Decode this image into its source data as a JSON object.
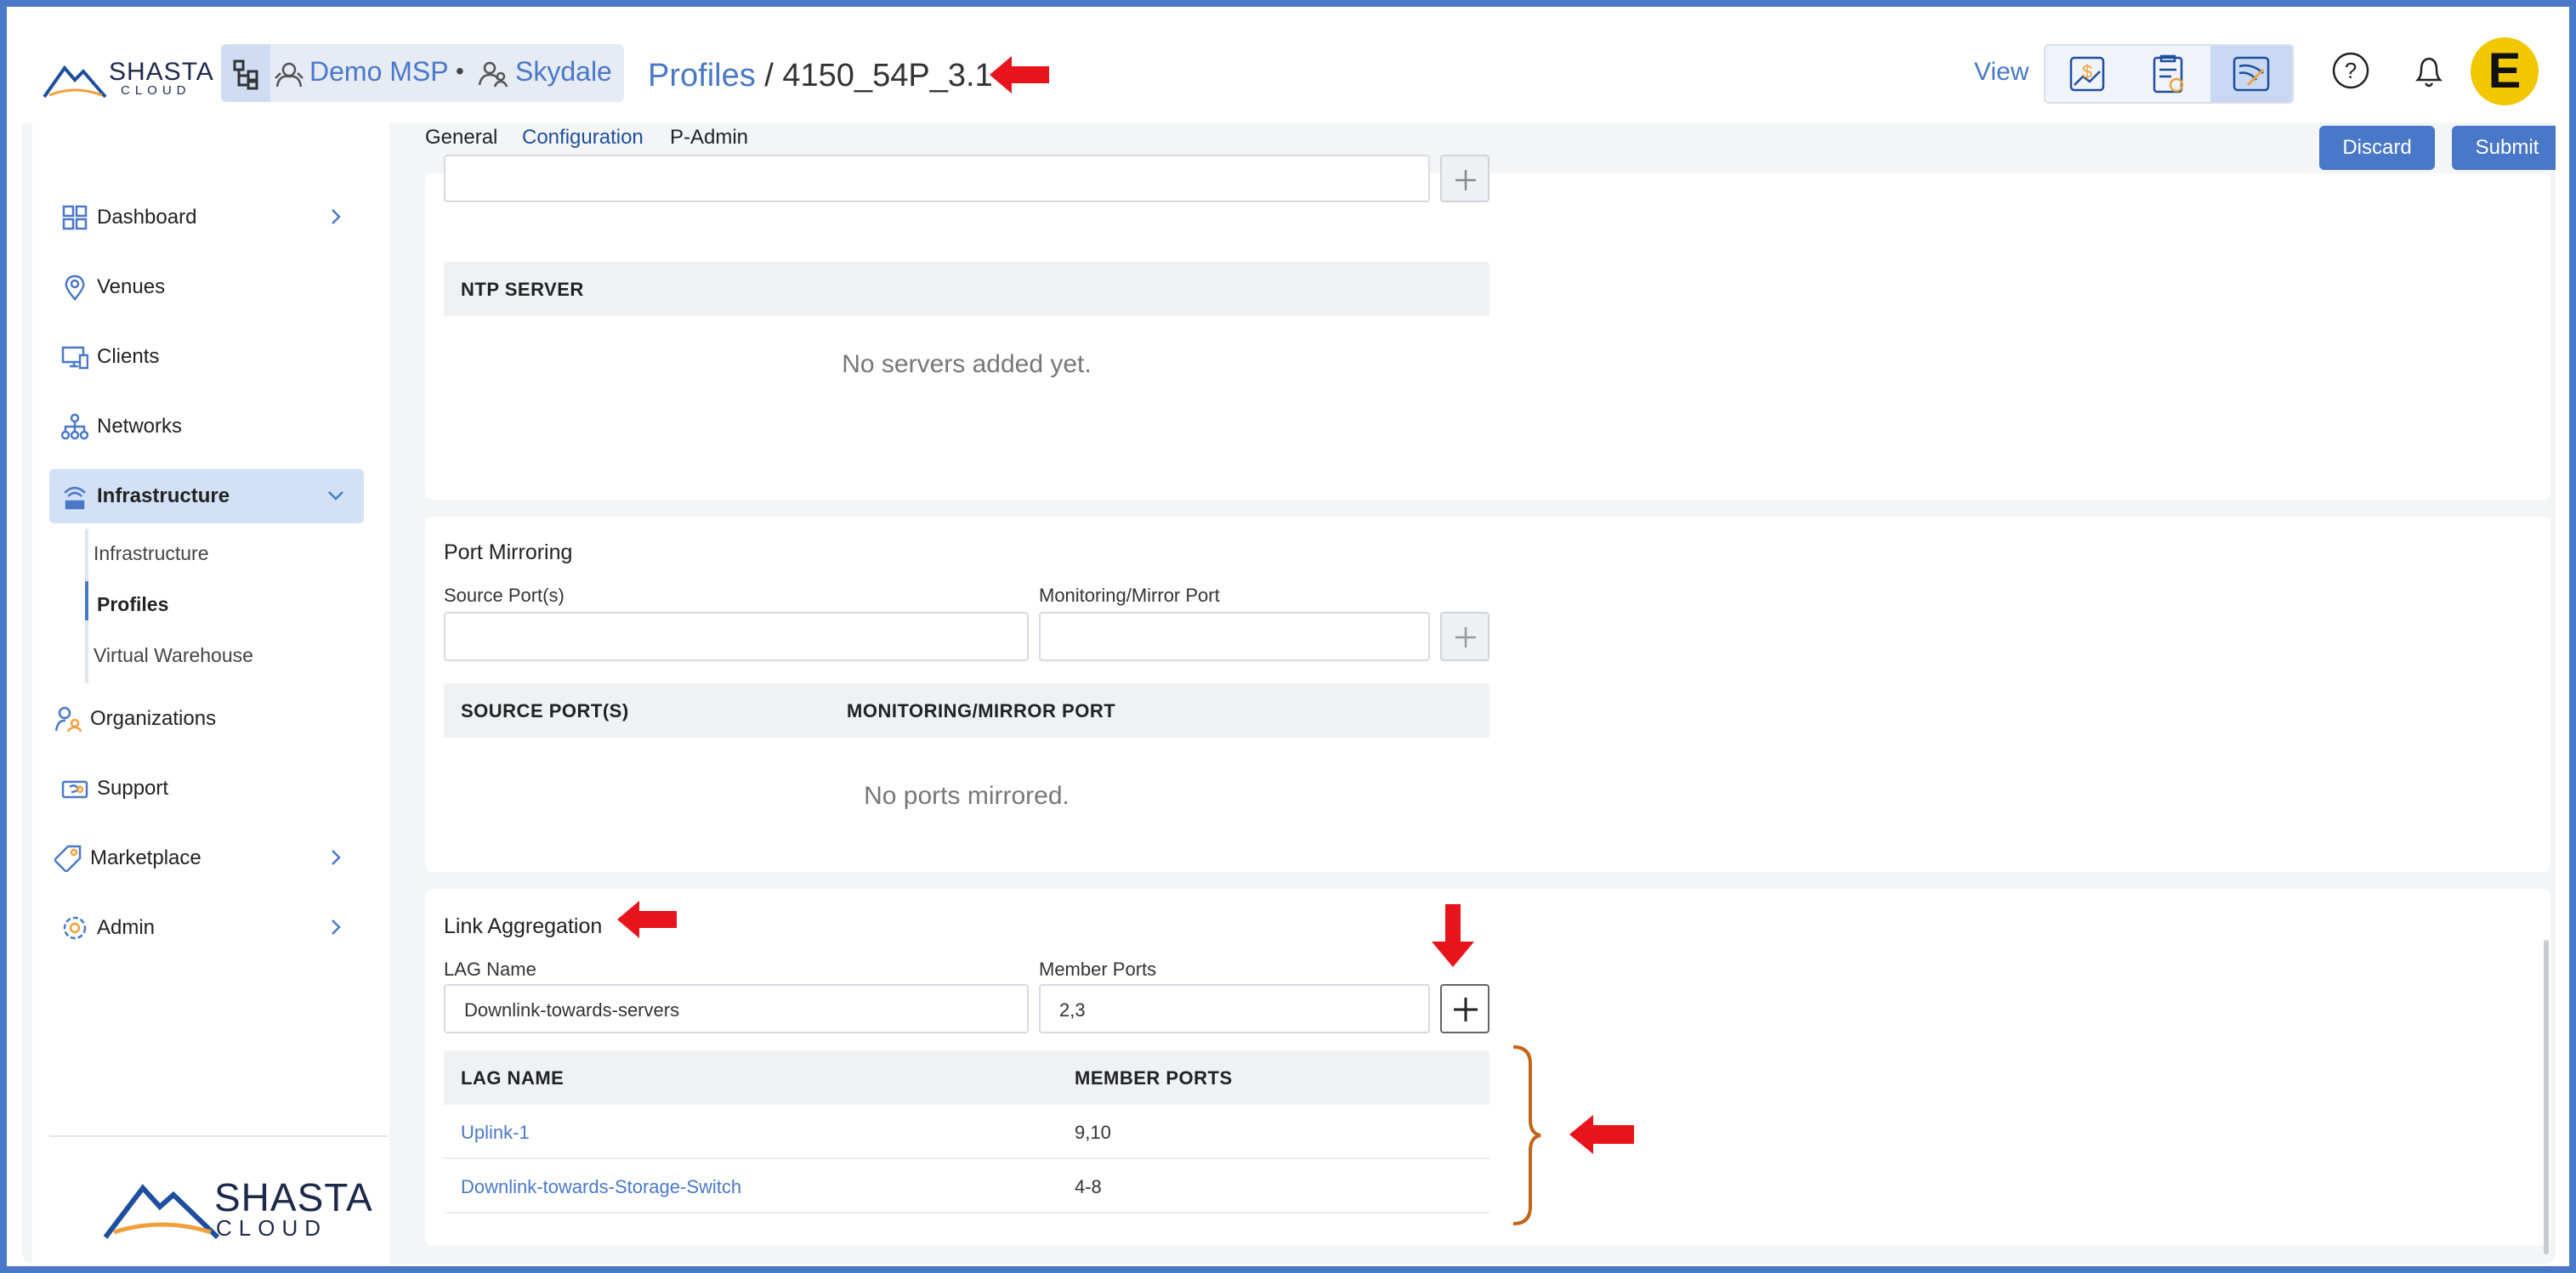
{
  "header": {
    "logo": {
      "word": "SHASTA",
      "sub": "CLOUD"
    },
    "context": {
      "msp": "Demo MSP",
      "separator": "•",
      "org": "Skydale"
    },
    "breadcrumb": {
      "parent": "Profiles",
      "sep": "/",
      "current": "4150_54P_3.1"
    },
    "view_label": "View",
    "icons": [
      "billing-icon",
      "report-icon",
      "network-icon",
      "help-icon",
      "bell-icon",
      "user-avatar"
    ],
    "avatar_letter": "E"
  },
  "sidebar": {
    "items": [
      {
        "label": "Dashboard",
        "icon": "dashboard-icon",
        "chevron": true
      },
      {
        "label": "Venues",
        "icon": "location-icon"
      },
      {
        "label": "Clients",
        "icon": "devices-icon"
      },
      {
        "label": "Networks",
        "icon": "network-tree-icon"
      },
      {
        "label": "Infrastructure",
        "icon": "infrastructure-icon",
        "expanded": true
      },
      {
        "label": "Organizations",
        "icon": "organizations-icon"
      },
      {
        "label": "Support",
        "icon": "support-icon"
      },
      {
        "label": "Marketplace",
        "icon": "tag-icon",
        "chevron": true
      },
      {
        "label": "Admin",
        "icon": "admin-gear-icon",
        "chevron": true
      }
    ],
    "subitems": [
      "Infrastructure",
      "Profiles",
      "Virtual Warehouse"
    ],
    "selected_subitem": "Profiles",
    "footer_logo": {
      "word": "SHASTA",
      "sub": "CLOUD"
    }
  },
  "tabs": [
    "General",
    "Configuration",
    "P-Admin"
  ],
  "active_tab": "Configuration",
  "actions": {
    "discard": "Discard",
    "submit": "Submit"
  },
  "ntp": {
    "table_header": "NTP SERVER",
    "empty": "No servers added yet."
  },
  "port_mirroring": {
    "title": "Port Mirroring",
    "source_label": "Source Port(s)",
    "monitor_label": "Monitoring/Mirror Port",
    "source_value": "",
    "monitor_value": "",
    "columns": [
      "SOURCE PORT(S)",
      "MONITORING/MIRROR PORT"
    ],
    "empty": "No ports mirrored."
  },
  "link_aggregation": {
    "title": "Link Aggregation",
    "lag_name_label": "LAG Name",
    "member_ports_label": "Member Ports",
    "lag_name_value": "Downlink-towards-servers",
    "member_ports_value": "2,3",
    "columns": [
      "LAG NAME",
      "MEMBER PORTS"
    ],
    "rows": [
      {
        "name": "Uplink-1",
        "ports": "9,10"
      },
      {
        "name": "Downlink-towards-Storage-Switch",
        "ports": "4-8"
      }
    ]
  },
  "annotation_colors": {
    "arrow": "#e8141b",
    "bracket": "#c0651a",
    "accent": "#4a78c8"
  }
}
